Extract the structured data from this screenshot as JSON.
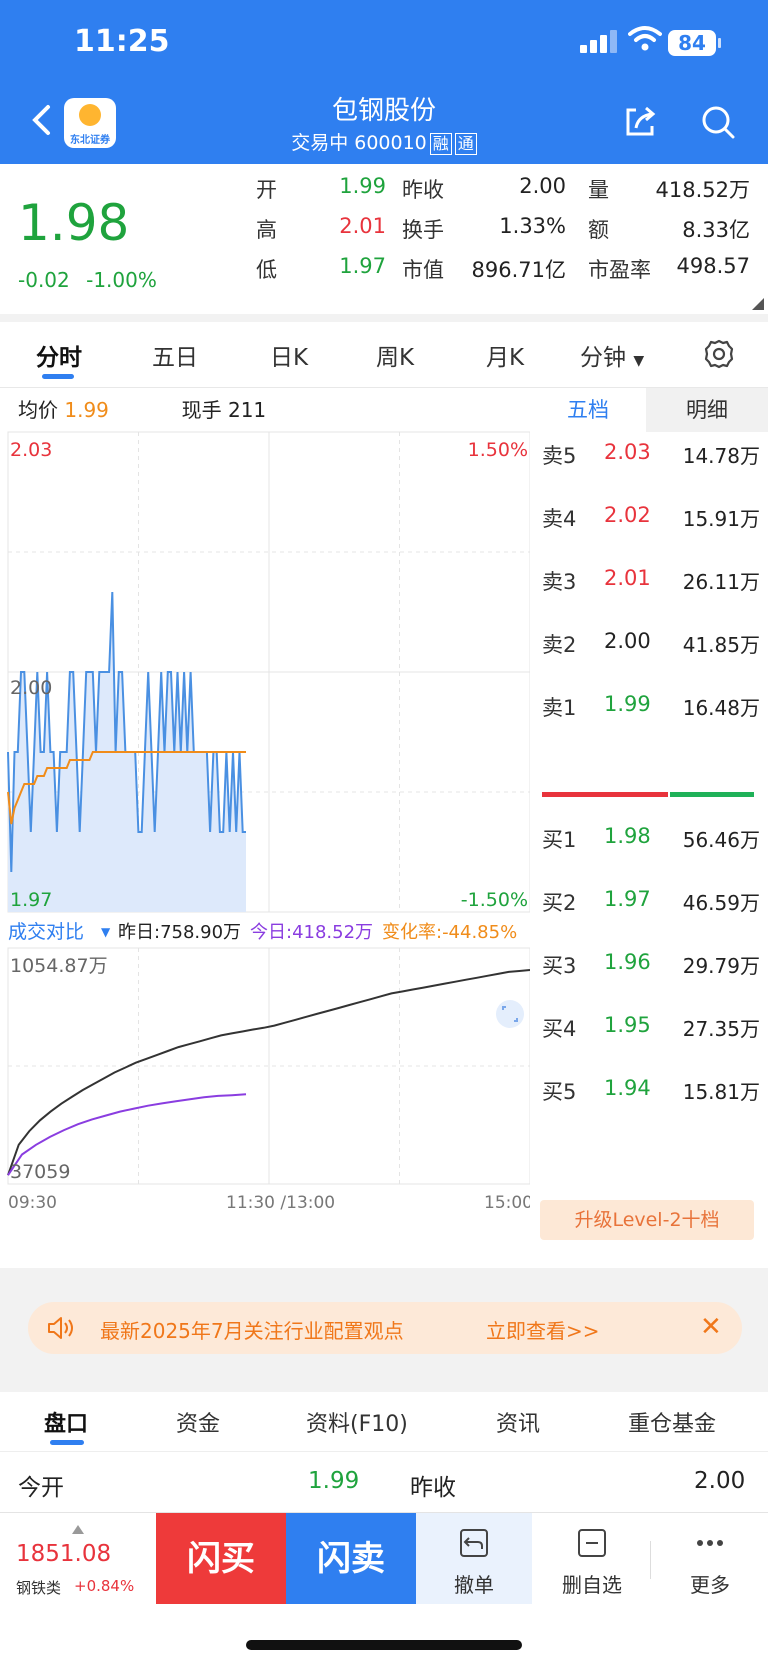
{
  "status_bar": {
    "time": "11:25",
    "battery": "84"
  },
  "header": {
    "title": "包钢股份",
    "status": "交易中 600010",
    "tags": [
      "融",
      "通"
    ],
    "logo_text": "东北证券"
  },
  "quote": {
    "price": "1.98",
    "change": "-0.02",
    "change_pct": "-1.00%",
    "open_label": "开",
    "open": "1.99",
    "prev_close_label": "昨收",
    "prev_close": "2.00",
    "volume_label": "量",
    "volume": "418.52万",
    "high_label": "高",
    "high": "2.01",
    "turnover_label": "换手",
    "turnover": "1.33%",
    "amount_label": "额",
    "amount": "8.33亿",
    "low_label": "低",
    "low": "1.97",
    "mktcap_label": "市值",
    "mktcap": "896.71亿",
    "pe_label": "市盈率",
    "pe": "498.57"
  },
  "chart_tabs": [
    "分时",
    "五日",
    "日K",
    "周K",
    "月K",
    "分钟"
  ],
  "intraday": {
    "avg_label": "均价",
    "avg_value": "1.99",
    "hand_label": "现手",
    "hand_value": "211",
    "ymax_label": "2.03",
    "ymid_label": "2.00",
    "ymin_label": "1.97",
    "pct_top_label": "1.50%",
    "pct_bottom_label": "-1.50%",
    "compare_label": "成交对比",
    "yesterday_label": "昨日:758.90万",
    "today_label": "今日:418.52万",
    "change_rate_label": "变化率:-44.85%",
    "vol_max_label": "1054.87万",
    "vol_min_label": "37059",
    "x_labels": [
      "09:30",
      "11:30 /13:00",
      "15:00"
    ]
  },
  "chart_data": {
    "type": "line",
    "x_range": [
      "09:30",
      "15:00"
    ],
    "ylim": [
      1.97,
      2.03
    ],
    "series": [
      {
        "name": "",
        "color": "#4a90e2",
        "values": [
          1.99,
          1.975,
          1.99,
          1.99,
          2.0,
          2.0,
          1.99,
          1.98,
          1.99,
          2.0,
          1.99,
          1.99,
          2.0,
          1.99,
          1.99,
          1.98,
          1.99,
          1.99,
          1.99,
          2.0,
          2.0,
          1.99,
          1.98,
          1.99,
          2.0,
          2.0,
          2.0,
          1.99,
          2.0,
          2.0,
          2.0,
          2.0,
          2.01,
          1.99,
          2.0,
          2.0,
          1.99,
          1.99,
          1.99,
          1.99,
          1.98,
          1.98,
          1.99,
          2.0,
          1.99,
          1.98,
          1.99,
          2.0,
          1.99,
          2.0,
          2.0,
          1.99,
          2.0,
          1.99,
          2.0,
          1.99,
          2.0,
          1.99,
          1.99,
          1.99,
          1.99,
          1.99,
          1.98,
          1.99,
          1.99,
          1.98,
          1.98,
          1.99,
          1.98,
          1.99,
          1.98,
          1.99,
          1.98,
          1.98
        ]
      },
      {
        "name": "均价",
        "color": "#f08c1a",
        "values": [
          1.985,
          1.981,
          1.983,
          1.984,
          1.985,
          1.986,
          1.986,
          1.986,
          1.986,
          1.987,
          1.987,
          1.987,
          1.988,
          1.988,
          1.988,
          1.988,
          1.988,
          1.988,
          1.988,
          1.989,
          1.989,
          1.989,
          1.989,
          1.989,
          1.989,
          1.989,
          1.99,
          1.99,
          1.99,
          1.99,
          1.99,
          1.99,
          1.99,
          1.99,
          1.99,
          1.99,
          1.99,
          1.99,
          1.99,
          1.99,
          1.99,
          1.99,
          1.99,
          1.99,
          1.99,
          1.99,
          1.99,
          1.99,
          1.99,
          1.99,
          1.99,
          1.99,
          1.99,
          1.99,
          1.99,
          1.99,
          1.99,
          1.99,
          1.99,
          1.99,
          1.99,
          1.99,
          1.99,
          1.99,
          1.99,
          1.99,
          1.99,
          1.99,
          1.99,
          1.99,
          1.99,
          1.99,
          1.99,
          1.99
        ]
      }
    ],
    "volume_compare": {
      "ylim": [
        0,
        1054.87
      ],
      "yesterday_cum": [
        4,
        160,
        230,
        285,
        330,
        370,
        405,
        440,
        470,
        500,
        530,
        555,
        580,
        600,
        620,
        640,
        660,
        675,
        690,
        705,
        720,
        730,
        740,
        750,
        758.9,
        770,
        785,
        800,
        815,
        830,
        845,
        860,
        875,
        890,
        905,
        920,
        935,
        945,
        955,
        965,
        975,
        985,
        995,
        1005,
        1015,
        1025,
        1035,
        1045,
        1050,
        1054.87
      ],
      "today_cum": [
        4,
        110,
        160,
        200,
        235,
        265,
        290,
        310,
        330,
        345,
        360,
        372,
        383,
        393,
        403,
        410,
        414,
        418.52
      ]
    }
  },
  "orderbook": {
    "tab_active": "五档",
    "tab_inactive": "明细",
    "asks": [
      {
        "label": "卖5",
        "price": "2.03",
        "vol": "14.78万",
        "color": "red"
      },
      {
        "label": "卖4",
        "price": "2.02",
        "vol": "15.91万",
        "color": "red"
      },
      {
        "label": "卖3",
        "price": "2.01",
        "vol": "26.11万",
        "color": "red"
      },
      {
        "label": "卖2",
        "price": "2.00",
        "vol": "41.85万",
        "color": "black"
      },
      {
        "label": "卖1",
        "price": "1.99",
        "vol": "16.48万",
        "color": "green"
      }
    ],
    "bids": [
      {
        "label": "买1",
        "price": "1.98",
        "vol": "56.46万"
      },
      {
        "label": "买2",
        "price": "1.97",
        "vol": "46.59万"
      },
      {
        "label": "买3",
        "price": "1.96",
        "vol": "29.79万"
      },
      {
        "label": "买4",
        "price": "1.95",
        "vol": "27.35万"
      },
      {
        "label": "买5",
        "price": "1.94",
        "vol": "15.81万"
      }
    ],
    "upgrade_label": "升级Level-2十档"
  },
  "promo": {
    "message": "最新2025年7月关注行业配置观点",
    "action": "立即查看>>"
  },
  "bottom_tabs": [
    "盘口",
    "资金",
    "资料(F10)",
    "资讯",
    "重仓基金"
  ],
  "open_row": {
    "open_label": "今开",
    "open_value": "1.99",
    "prev_label": "昨收",
    "prev_value": "2.00"
  },
  "toolbar": {
    "index_value": "1851.08",
    "index_name": "钢铁类",
    "index_change": "+0.84%",
    "flash_buy": "闪买",
    "flash_sell": "闪卖",
    "cancel": "撤单",
    "unwatch": "删自选",
    "more": "更多"
  }
}
